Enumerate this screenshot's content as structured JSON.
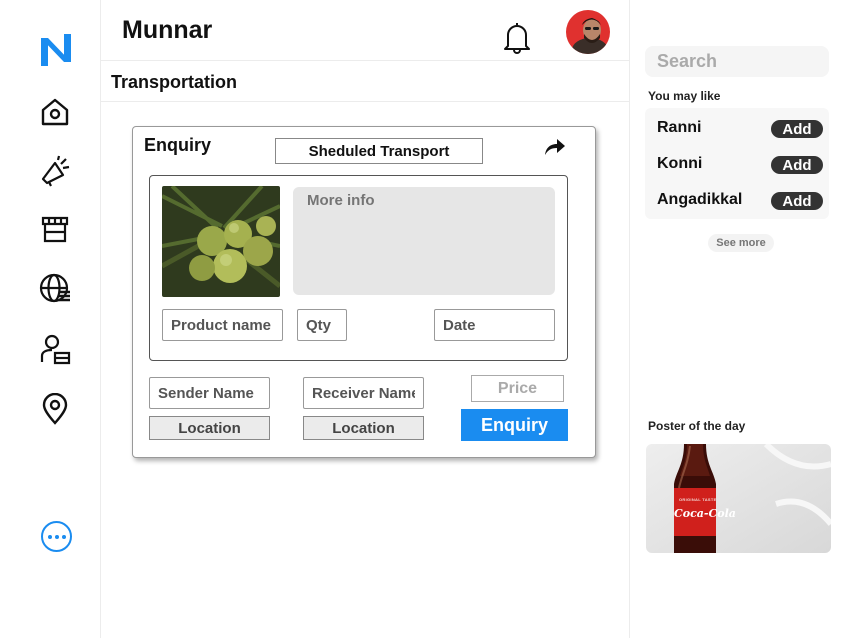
{
  "header": {
    "city": "Munnar",
    "page_title": "Transportation"
  },
  "nav": {
    "items": [
      "home-icon",
      "megaphone-icon",
      "store-icon",
      "globe-icon",
      "user-icon",
      "location-pin-icon"
    ]
  },
  "enquiry_card": {
    "title": "Enquiry",
    "scheduled_label": "Sheduled Transport",
    "more_info_placeholder": "More info",
    "product_name_placeholder": "Product name",
    "qty_placeholder": "Qty",
    "date_placeholder": "Date",
    "sender_name_placeholder": "Sender Name",
    "receiver_name_placeholder": "Receiver Name",
    "price_placeholder": "Price",
    "sender_location_label": "Location",
    "receiver_location_label": "Location",
    "submit_label": "Enquiry"
  },
  "right_panel": {
    "search_placeholder": "Search",
    "you_may_like_label": "You may like",
    "suggestions": [
      {
        "name": "Ranni",
        "action": "Add"
      },
      {
        "name": "Konni",
        "action": "Add"
      },
      {
        "name": "Angadikkal",
        "action": "Add"
      }
    ],
    "see_more_label": "See more",
    "poster_label": "Poster of the day",
    "poster_brand_text": "Coca-Cola",
    "poster_bottle_text": "ORIGINAL TASTE"
  },
  "colors": {
    "accent": "#1a8cf0",
    "add_button": "#333333"
  }
}
